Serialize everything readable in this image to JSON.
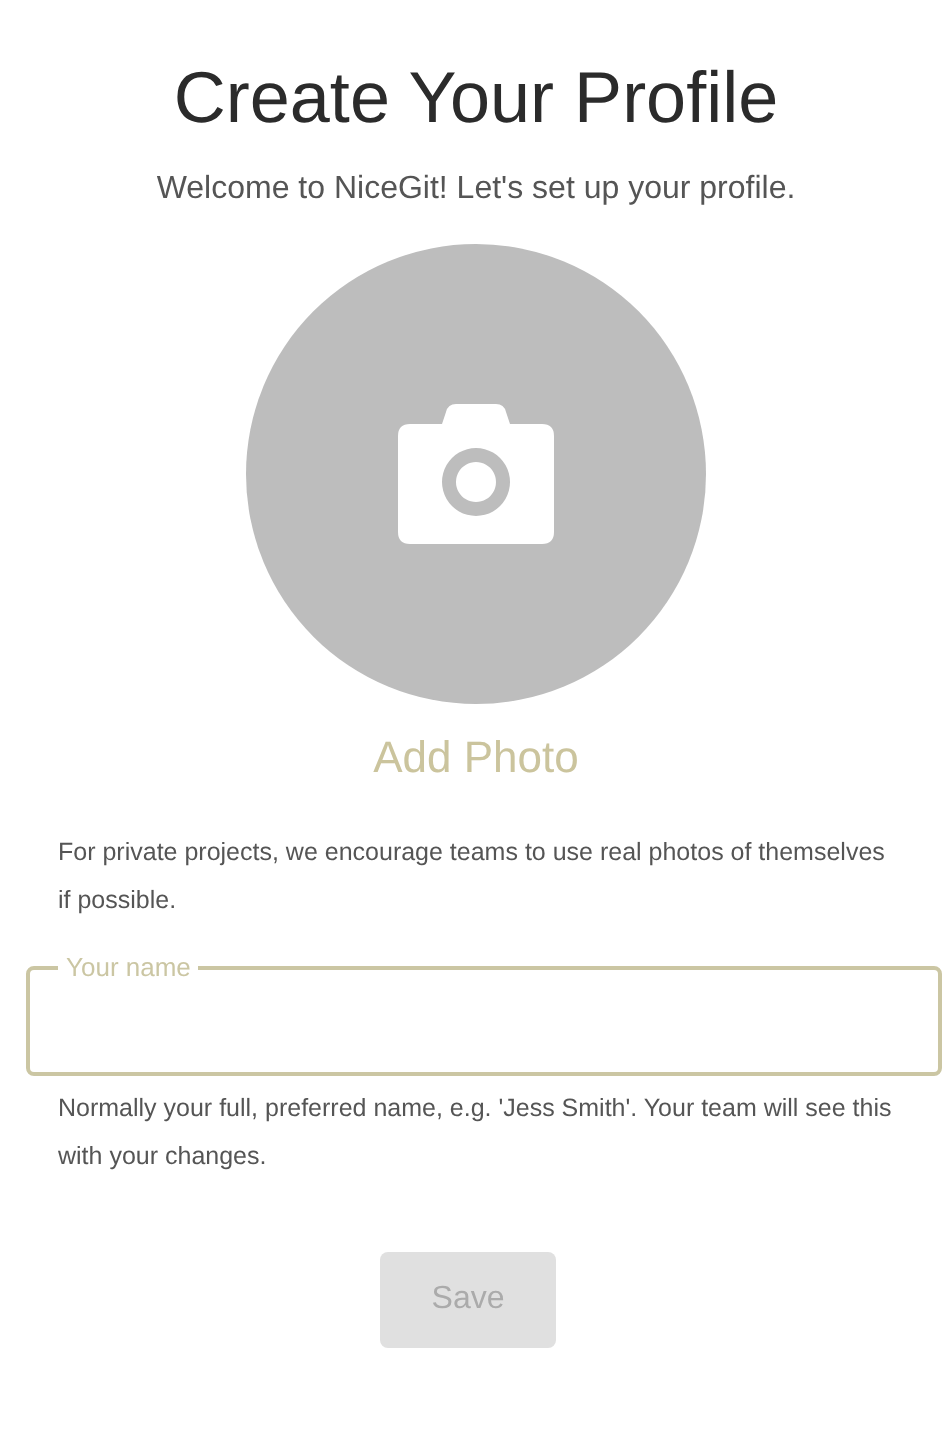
{
  "title": "Create Your Profile",
  "subtitle": "Welcome to NiceGit! Let's set up your profile.",
  "photo": {
    "label": "Add Photo"
  },
  "photo_note": "For private projects, we encourage teams to use real photos of themselves if possible.",
  "name_field": {
    "label": "Your name"
  },
  "name_help": "Normally your full, preferred name, e.g. 'Jess Smith'. Your team will see this with your changes.",
  "save_button": {
    "label": "Save",
    "disabled": true
  }
}
